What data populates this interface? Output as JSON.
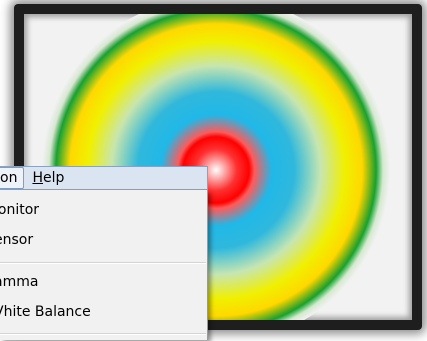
{
  "menubar": {
    "partial_label": "on",
    "help_label": "Help",
    "help_mnemonic": "H",
    "help_rest": "elp"
  },
  "dropdown": {
    "items": [
      {
        "label": "lonitor"
      },
      {
        "label": "ensor"
      },
      {
        "label": "amma"
      },
      {
        "label": "Vhite Balance"
      }
    ]
  },
  "image": {
    "description_colors": [
      "#ffffff",
      "#ff0000",
      "#20b8e8",
      "#f0f000",
      "#18a030"
    ]
  }
}
